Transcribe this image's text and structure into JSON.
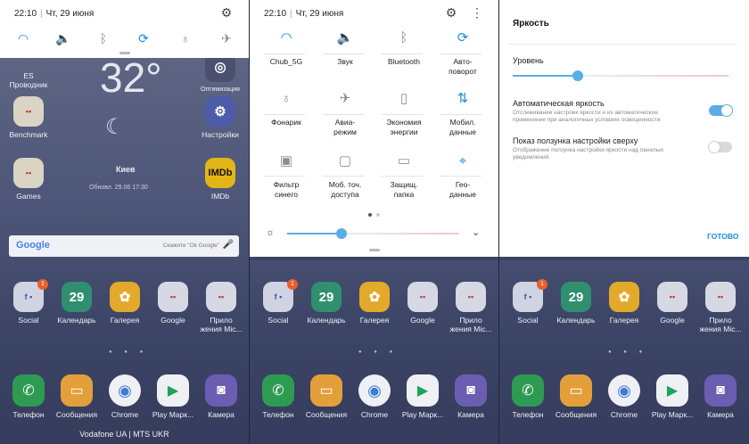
{
  "status": {
    "time": "22:10",
    "date": "Чт, 29 июня"
  },
  "colors": {
    "accent": "#1a8dd9",
    "toggle_on": "#5aaee6",
    "badge": "#e9602e"
  },
  "home": {
    "weather": {
      "temp": "32°",
      "city": "Киев",
      "updated": "Обновл. 29.06 17:30"
    },
    "top_apps": [
      {
        "label": "ES\nПроводник",
        "icon": "es-explorer-icon"
      },
      {
        "label": "Оптимизация",
        "icon": "optimization-icon"
      }
    ],
    "row_apps_left": [
      {
        "label": "Benchmark",
        "icon": "folder-icon"
      },
      {
        "label": "Games",
        "icon": "folder-icon"
      }
    ],
    "row_apps_right": [
      {
        "label": "Настройки",
        "icon": "gear-icon"
      },
      {
        "label": "IMDb",
        "icon": "imdb-icon",
        "text": "IMDb"
      }
    ],
    "search": {
      "logo": "Google",
      "placeholder": "Скажите \"Ok Google\""
    },
    "apps": [
      {
        "label": "Social",
        "icon": "folder-icon",
        "badge": "1"
      },
      {
        "label": "Календарь",
        "icon": "calendar-icon",
        "text": "29"
      },
      {
        "label": "Галерея",
        "icon": "gallery-icon"
      },
      {
        "label": "Google",
        "icon": "folder-icon"
      },
      {
        "label": "Прило\nжения Mic...",
        "icon": "folder-icon"
      }
    ],
    "dock": [
      {
        "label": "Телефон",
        "icon": "phone-icon"
      },
      {
        "label": "Сообщения",
        "icon": "messages-icon"
      },
      {
        "label": "Chrome",
        "icon": "chrome-icon"
      },
      {
        "label": "Play Марк...",
        "icon": "play-store-icon"
      },
      {
        "label": "Камера",
        "icon": "camera-icon"
      }
    ],
    "carrier": "Vodafone UA | MTS UKR"
  },
  "quick_panel": {
    "tiles": [
      {
        "label": "Chub_5G",
        "icon": "wifi-icon",
        "active": true
      },
      {
        "label": "Звук",
        "icon": "sound-icon",
        "active": true
      },
      {
        "label": "Bluetooth",
        "icon": "bluetooth-icon",
        "active": false
      },
      {
        "label": "Авто-\nповорот",
        "icon": "auto-rotate-icon",
        "active": true
      },
      {
        "label": "Фонарик",
        "icon": "flashlight-icon",
        "active": false
      },
      {
        "label": "Авиа-\nрежим",
        "icon": "airplane-icon",
        "active": false
      },
      {
        "label": "Экономия\nэнергии",
        "icon": "battery-saver-icon",
        "active": false
      },
      {
        "label": "Мобил.\nданные",
        "icon": "mobile-data-icon",
        "active": true
      },
      {
        "label": "Фильтр\nсинего",
        "icon": "blue-filter-icon",
        "active": false
      },
      {
        "label": "Моб. точ.\nдоступа",
        "icon": "hotspot-icon",
        "active": false
      },
      {
        "label": "Защищ.\nпапка",
        "icon": "secure-folder-icon",
        "active": false
      },
      {
        "label": "Гео-\nданные",
        "icon": "location-icon",
        "active": true
      }
    ],
    "brightness_level": 0.32
  },
  "brightness_settings": {
    "title": "Яркость",
    "level_label": "Уровень",
    "level": 0.3,
    "auto": {
      "title": "Автоматическая яркость",
      "subtitle": "Отслеживание настроек яркости и их автоматическое применение при аналогичных условиях освещенности.",
      "on": true
    },
    "show_slider": {
      "title": "Показ ползунка настройки сверху",
      "subtitle": "Отображение ползунка настройки яркости над панелью уведомлений.",
      "on": false
    },
    "done": "ГОТОВО"
  }
}
